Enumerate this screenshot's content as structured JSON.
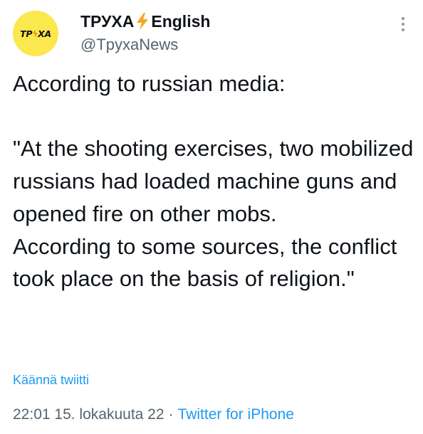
{
  "author": {
    "display_name_prefix": "ТРУХА",
    "display_name_suffix": "English",
    "handle": "@TpyxaNews",
    "avatar_text_left": "ТР",
    "avatar_text_right": "ХА"
  },
  "tweet": {
    "text": "According to russian media:\n\n\"At the shooting exercises, two mobilized russians had loaded machine guns and opened fire on other mobs.\nAccording to some sources, the conflict took place on the basis of religion.\"",
    "translate_label": "Käännä twiitti",
    "time": "22:01",
    "date": "15. lokakuuta 22",
    "separator": "·",
    "source": "Twitter for iPhone"
  },
  "colors": {
    "accent": "#1d9bf0",
    "avatar_bg": "#fbe74e",
    "bolt": "#f5a623",
    "secondary_text": "#536471"
  },
  "icons": {
    "more": "more-vertical-icon",
    "bolt": "lightning-bolt-icon"
  }
}
